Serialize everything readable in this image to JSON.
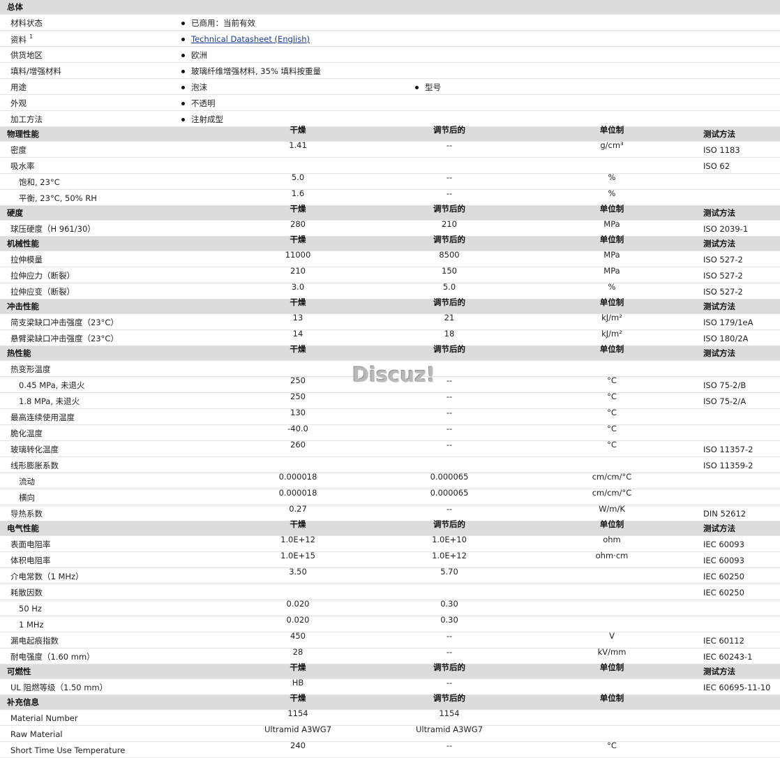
{
  "general": {
    "title": "总体",
    "rows": [
      {
        "name": "材料状态",
        "val": "已商用：当前有效"
      },
      {
        "name": "资料",
        "sup": "1",
        "link": "Technical Datasheet (English)"
      },
      {
        "name": "供货地区",
        "val": "欧洲"
      },
      {
        "name": "填料/增强材料",
        "val": "玻璃纤维增强材料, 35% 填料按重量"
      },
      {
        "name": "用途",
        "val": "泡沫",
        "val2": "型号"
      },
      {
        "name": "外观",
        "val": "不透明"
      },
      {
        "name": "加工方法",
        "val": "注射成型"
      }
    ]
  },
  "columns": {
    "dry": "干燥",
    "cond": "调节后的",
    "unit": "单位制",
    "test": "测试方法"
  },
  "sections": [
    {
      "title": "物理性能",
      "rows": [
        {
          "name": "密度",
          "dry": "1.41",
          "cond": "--",
          "unit": "g/cm³",
          "test": "ISO 1183"
        },
        {
          "name": "吸水率",
          "dry": "",
          "cond": "",
          "unit": "",
          "test": "ISO 62"
        },
        {
          "name": "饱和, 23°C",
          "sub": true,
          "dry": "5.0",
          "cond": "--",
          "unit": "%",
          "test": ""
        },
        {
          "name": "平衡, 23°C, 50% RH",
          "sub": true,
          "dry": "1.6",
          "cond": "--",
          "unit": "%",
          "test": ""
        }
      ]
    },
    {
      "title": "硬度",
      "rows": [
        {
          "name": "球压硬度（H 961/30）",
          "dry": "280",
          "cond": "210",
          "unit": "MPa",
          "test": "ISO 2039-1"
        }
      ]
    },
    {
      "title": "机械性能",
      "rows": [
        {
          "name": "拉伸模量",
          "dry": "11000",
          "cond": "8500",
          "unit": "MPa",
          "test": "ISO 527-2"
        },
        {
          "name": "拉伸应力（断裂）",
          "dry": "210",
          "cond": "150",
          "unit": "MPa",
          "test": "ISO 527-2"
        },
        {
          "name": "拉伸应变（断裂）",
          "dry": "3.0",
          "cond": "5.0",
          "unit": "%",
          "test": "ISO 527-2"
        }
      ]
    },
    {
      "title": "冲击性能",
      "rows": [
        {
          "name": "简支梁缺口冲击强度（23°C）",
          "dry": "13",
          "cond": "21",
          "unit": "kJ/m²",
          "test": "ISO 179/1eA"
        },
        {
          "name": "悬臂梁缺口冲击强度（23°C）",
          "dry": "14",
          "cond": "18",
          "unit": "kJ/m²",
          "test": "ISO 180/2A"
        }
      ]
    },
    {
      "title": "热性能",
      "rows": [
        {
          "name": "热变形温度",
          "dry": "",
          "cond": "",
          "unit": "",
          "test": ""
        },
        {
          "name": "0.45 MPa, 未退火",
          "sub": true,
          "dry": "250",
          "cond": "--",
          "unit": "°C",
          "test": "ISO 75-2/B"
        },
        {
          "name": "1.8 MPa, 未退火",
          "sub": true,
          "dry": "250",
          "cond": "--",
          "unit": "°C",
          "test": "ISO 75-2/A"
        },
        {
          "name": "最高连续使用温度",
          "dry": "130",
          "cond": "--",
          "unit": "°C",
          "test": ""
        },
        {
          "name": "脆化温度",
          "dry": "-40.0",
          "cond": "--",
          "unit": "°C",
          "test": ""
        },
        {
          "name": "玻璃转化温度",
          "dry": "260",
          "cond": "--",
          "unit": "°C",
          "test": "ISO 11357-2"
        },
        {
          "name": "线形膨胀系数",
          "dry": "",
          "cond": "",
          "unit": "",
          "test": "ISO 11359-2"
        },
        {
          "name": "流动",
          "sub": true,
          "dry": "0.000018",
          "cond": "0.000065",
          "unit": "cm/cm/°C",
          "test": ""
        },
        {
          "name": "横向",
          "sub": true,
          "dry": "0.000018",
          "cond": "0.000065",
          "unit": "cm/cm/°C",
          "test": ""
        },
        {
          "name": "导热系数",
          "dry": "0.27",
          "cond": "--",
          "unit": "W/m/K",
          "test": "DIN 52612"
        }
      ]
    },
    {
      "title": "电气性能",
      "rows": [
        {
          "name": "表面电阻率",
          "dry": "1.0E+12",
          "cond": "1.0E+10",
          "unit": "ohm",
          "test": "IEC 60093"
        },
        {
          "name": "体积电阻率",
          "dry": "1.0E+15",
          "cond": "1.0E+12",
          "unit": "ohm·cm",
          "test": "IEC 60093"
        },
        {
          "name": "介电常数（1 MHz）",
          "dry": "3.50",
          "cond": "5.70",
          "unit": "",
          "test": "IEC 60250"
        },
        {
          "name": "耗散因数",
          "dry": "",
          "cond": "",
          "unit": "",
          "test": "IEC 60250"
        },
        {
          "name": "50 Hz",
          "sub": true,
          "dry": "0.020",
          "cond": "0.30",
          "unit": "",
          "test": ""
        },
        {
          "name": "1 MHz",
          "sub": true,
          "dry": "0.020",
          "cond": "0.30",
          "unit": "",
          "test": ""
        },
        {
          "name": "漏电起痕指数",
          "dry": "450",
          "cond": "--",
          "unit": "V",
          "test": "IEC 60112"
        },
        {
          "name": "耐电强度（1.60 mm）",
          "dry": "28",
          "cond": "--",
          "unit": "kV/mm",
          "test": "IEC 60243-1"
        }
      ]
    },
    {
      "title": "可燃性",
      "rows": [
        {
          "name": "UL 阻燃等级（1.50 mm）",
          "dry": "HB",
          "cond": "--",
          "unit": "",
          "test": "IEC 60695-11-10"
        }
      ]
    },
    {
      "title": "补充信息",
      "noTest": true,
      "rows": [
        {
          "name": "Material Number",
          "dry": "1154",
          "cond": "1154",
          "unit": "",
          "test": ""
        },
        {
          "name": "Raw Material",
          "dry": "Ultramid A3WG7",
          "cond": "Ultramid A3WG7",
          "unit": "",
          "test": ""
        },
        {
          "name": "Short Time Use Temperature",
          "dry": "240",
          "cond": "--",
          "unit": "°C",
          "test": ""
        }
      ]
    }
  ],
  "watermark": "Discuz!"
}
